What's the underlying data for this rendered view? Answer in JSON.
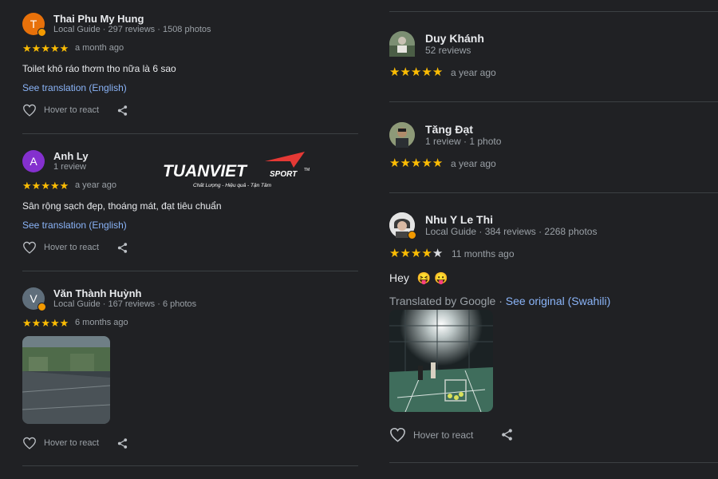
{
  "left_reviews": [
    {
      "avatar_letter": "T",
      "avatar_color": "#e8710a",
      "local_guide": true,
      "name": "Thai Phu My Hung",
      "meta": "Local Guide · 297 reviews · 1508 photos",
      "rating": 5,
      "date": "a month ago",
      "text": "Toilet khô ráo thơm tho nữa là 6 sao",
      "translation_link": "See translation (English)",
      "react_label": "Hover to react"
    },
    {
      "avatar_letter": "A",
      "avatar_color": "#8430ce",
      "local_guide": false,
      "name": "Anh Ly",
      "meta": "1 review",
      "rating": 5,
      "date": "a year ago",
      "text": "Sân rộng sạch đẹp, thoáng mát, đạt tiêu chuẩn",
      "translation_link": "See translation (English)",
      "react_label": "Hover to react"
    },
    {
      "avatar_letter": "V",
      "avatar_color": "#5f6e7b",
      "local_guide": true,
      "name": "Văn Thành Huỳnh",
      "meta": "Local Guide · 167 reviews · 6 photos",
      "rating": 5,
      "date": "6 months ago",
      "react_label": "Hover to react"
    }
  ],
  "right_reviews": [
    {
      "name": "Duy Khánh",
      "meta": "52 reviews",
      "rating": 5,
      "date": "a year ago"
    },
    {
      "name": "Tăng Đạt",
      "meta": "1 review · 1 photo",
      "rating": 5,
      "date": "a year ago"
    },
    {
      "name": "Nhu Y Le Thi",
      "meta": "Local Guide · 384 reviews · 2268 photos",
      "rating": 4,
      "date": "11 months ago",
      "text": "Hey",
      "emojis": "😝 😛",
      "translated_by": "Translated by Google ·",
      "see_original": "See original (Swahili)",
      "react_label": "Hover to react"
    }
  ],
  "watermark": {
    "brand": "TUANVIET",
    "brand_suffix": "SPORT",
    "tm": "TM",
    "tagline": "Chất Lượng - Hiệu quả - Tận Tâm"
  },
  "colors": {
    "background": "#202124",
    "star": "#fbbc04",
    "link": "#8ab4f8",
    "muted": "#9aa0a6",
    "brand_red": "#e53935"
  },
  "icons": {
    "react": "heart-outline-icon",
    "share": "share-icon"
  }
}
